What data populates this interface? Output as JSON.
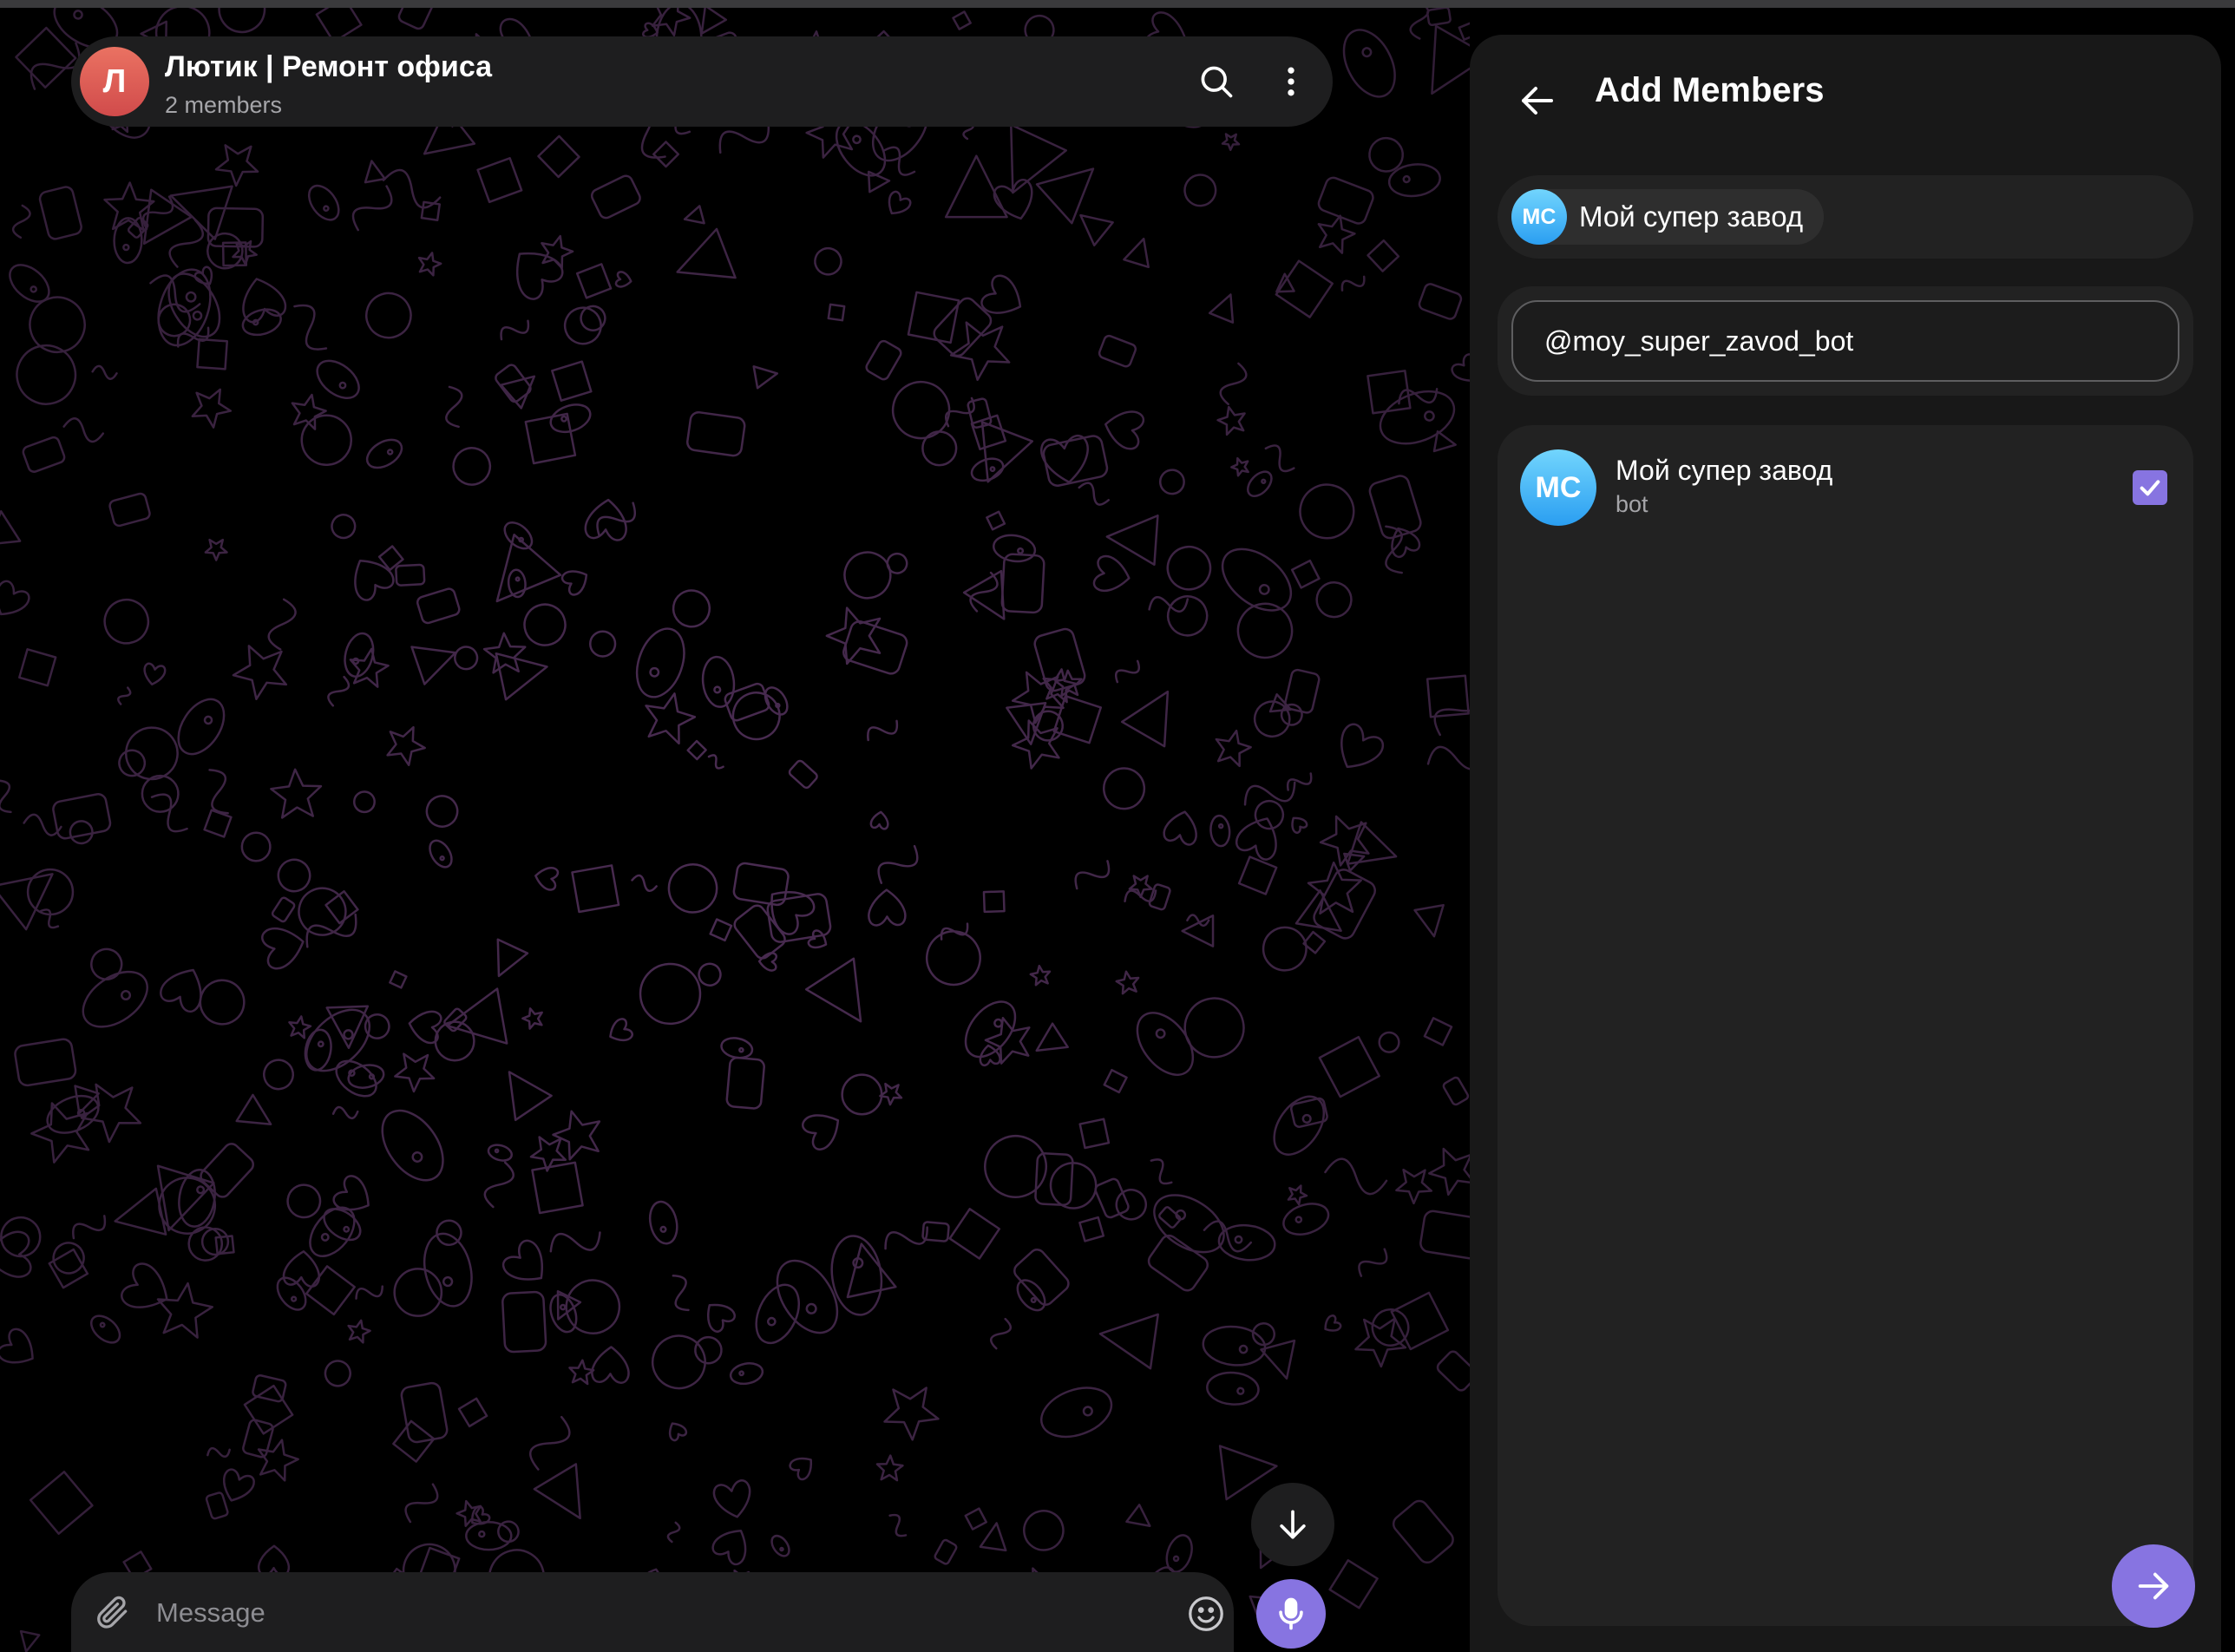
{
  "chat": {
    "avatar_letter": "Л",
    "title": "Лютик | Ремонт офиса",
    "subtitle": "2 members",
    "icons": {
      "search": "search-icon",
      "more": "more-vertical-icon",
      "scroll_down": "arrow-down-icon"
    },
    "composer": {
      "placeholder": "Message",
      "icons": {
        "attach": "paperclip-icon",
        "emoji": "smile-icon",
        "mic": "microphone-icon"
      }
    },
    "colors": {
      "accent": "#8774e1",
      "avatar": "#e0605a",
      "pattern": "#4a2c52"
    }
  },
  "panel": {
    "title": "Add Members",
    "back_icon": "arrow-left-icon",
    "selected_chips": [
      {
        "initials": "MC",
        "label": "Мой супер завод"
      }
    ],
    "search": {
      "value": "@moy_super_zavod_bot"
    },
    "results": [
      {
        "initials": "MC",
        "name": "Мой супер завод",
        "status": "bot",
        "checked": true
      }
    ],
    "confirm_icon": "arrow-right-icon"
  }
}
